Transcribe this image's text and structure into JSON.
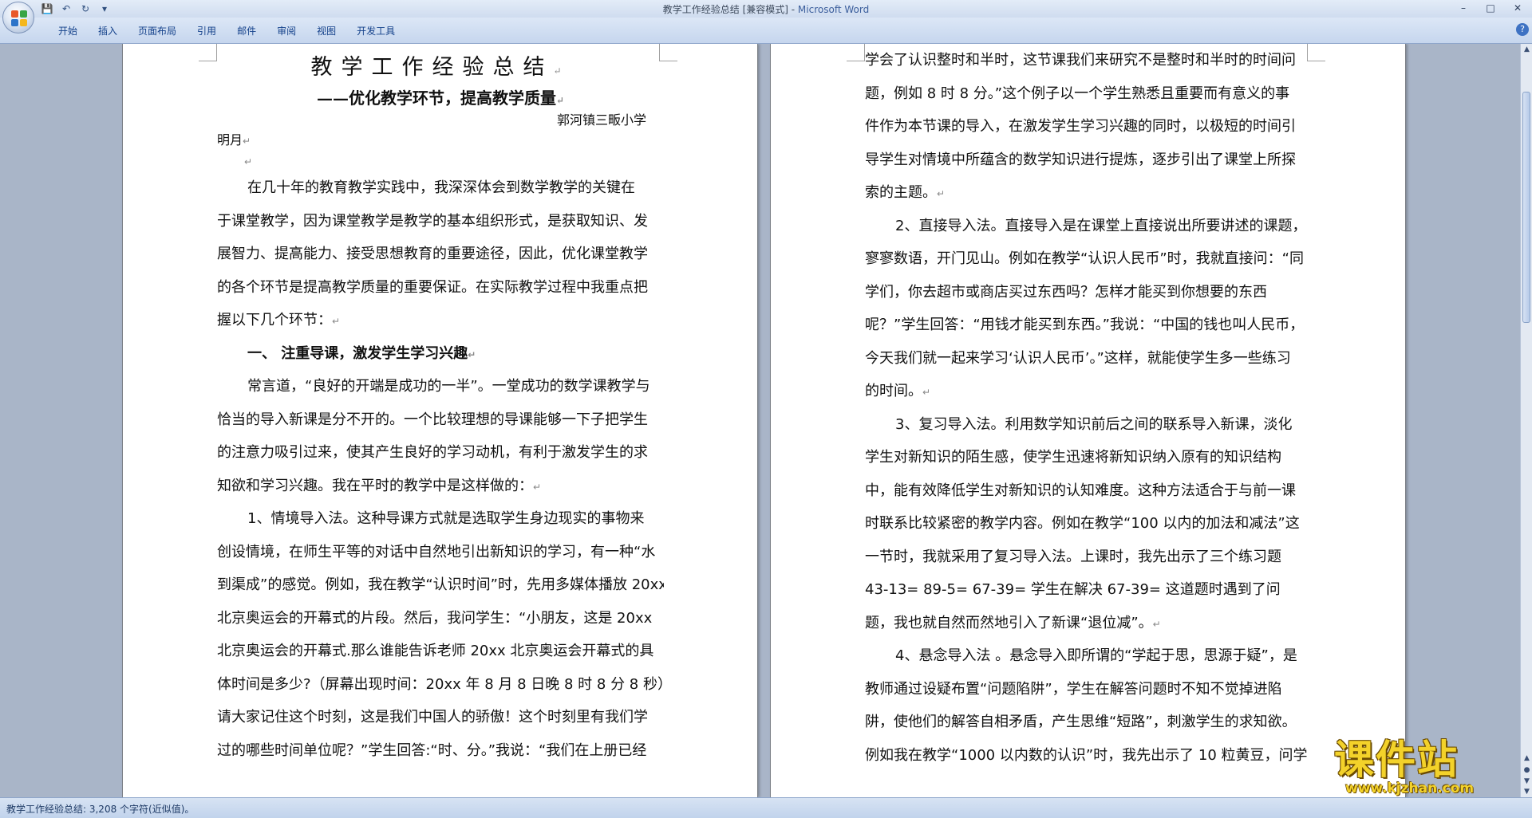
{
  "window": {
    "title": "教学工作经验总结 [兼容模式] - ",
    "app_name": "Microsoft Word"
  },
  "colors": {
    "office_logo": [
      "#e8572a",
      "#39a645",
      "#2d74c9",
      "#f5b71c"
    ],
    "watermark": "#f3d22a"
  },
  "ribbon": {
    "tabs": [
      "开始",
      "插入",
      "页面布局",
      "引用",
      "邮件",
      "审阅",
      "视图",
      "开发工具"
    ],
    "help": "?"
  },
  "qat": {
    "save": "💾",
    "undo": "↶",
    "redo": "↻",
    "customize": "▾"
  },
  "win_controls": {
    "minimize": "–",
    "maximize": "□",
    "close": "✕"
  },
  "doc": {
    "title": "教学工作经验总结",
    "subtitle": "——优化教学环节，提高教学质量",
    "author_line1": "郭河镇三畈小学",
    "author_line2": "明月",
    "para_mark": "↵",
    "left_lines": [
      "在几十年的教育教学实践中，我深深体会到数学教学的关键在",
      "于课堂教学，因为课堂教学是教学的基本组织形式，是获取知识、发",
      "展智力、提高能力、接受思想教育的重要途径，因此，优化课堂教学",
      "的各个环节是提高教学质量的重要保证。在实际教学过程中我重点把",
      "握以下几个环节：",
      "一、  注重导课，激发学生学习兴趣",
      "常言道，“良好的开端是成功的一半”。一堂成功的数学课教学与",
      "恰当的导入新课是分不开的。一个比较理想的导课能够一下子把学生",
      "的注意力吸引过来，使其产生良好的学习动机，有利于激发学生的求",
      "知欲和学习兴趣。我在平时的教学中是这样做的：",
      "1、情境导入法。这种导课方式就是选取学生身边现实的事物来",
      "创设情境，在师生平等的对话中自然地引出新知识的学习，有一种“水",
      "到渠成”的感觉。例如，我在教学“认识时间”时，先用多媒体播放 20xx",
      "北京奥运会的开幕式的片段。然后，我问学生：“小朋友，这是 20xx",
      "北京奥运会的开幕式.那么谁能告诉老师 20xx 北京奥运会开幕式的具",
      "体时间是多少?（屏幕出现时间：20xx 年 8 月 8 日晚 8 时 8 分 8 秒）",
      "请大家记住这个时刻，这是我们中国人的骄傲！这个时刻里有我们学",
      "过的哪些时间单位呢？”学生回答:“时、分。”我说：“我们在上册已经"
    ],
    "right_lines": [
      "学会了认识整时和半时，这节课我们来研究不是整时和半时的时间问",
      "题，例如 8 时 8 分。”这个例子以一个学生熟悉且重要而有意义的事",
      "件作为本节课的导入，在激发学生学习兴趣的同时，以极短的时间引",
      "导学生对情境中所蕴含的数学知识进行提炼，逐步引出了课堂上所探",
      "索的主题。",
      "2、直接导入法。直接导入是在课堂上直接说出所要讲述的课题，",
      "寥寥数语，开门见山。例如在教学“认识人民币”时，我就直接问：“同",
      "学们，你去超市或商店买过东西吗？怎样才能买到你想要的东西",
      "呢？”学生回答：“用钱才能买到东西。”我说：“中国的钱也叫人民币，",
      "今天我们就一起来学习‘认识人民币’。”这样，就能使学生多一些练习",
      "的时间。",
      "3、复习导入法。利用数学知识前后之间的联系导入新课，淡化",
      "学生对新知识的陌生感，使学生迅速将新知识纳入原有的知识结构",
      "中，能有效降低学生对新知识的认知难度。这种方法适合于与前一课",
      "时联系比较紧密的教学内容。例如在教学“100 以内的加法和减法”这",
      "一节时，我就采用了复习导入法。上课时，我先出示了三个练习题",
      "43-13=    89-5=    67-39= 学生在解决 67-39=  这道题时遇到了问",
      "题，我也就自然而然地引入了新课“退位减”。",
      "4、悬念导入法 。悬念导入即所谓的“学起于思，思源于疑”，是",
      "教师通过设疑布置“问题陷阱”，学生在解答问题时不知不觉掉进陷",
      "阱，使他们的解答自相矛盾，产生思维“短路”，刺激学生的求知欲。",
      "例如我在教学“1000 以内数的认识”时，我先出示了 10 粒黄豆，问学"
    ]
  },
  "scrollbar": {
    "up": "▲",
    "down": "▼",
    "prev_page": "▲",
    "next_page": "▼",
    "select_browse": "●"
  },
  "status": {
    "text": "教学工作经验总结: 3,208 个字符(近似值)。"
  },
  "watermark": {
    "main": "课件站",
    "url": "www.kjzhan.com"
  }
}
